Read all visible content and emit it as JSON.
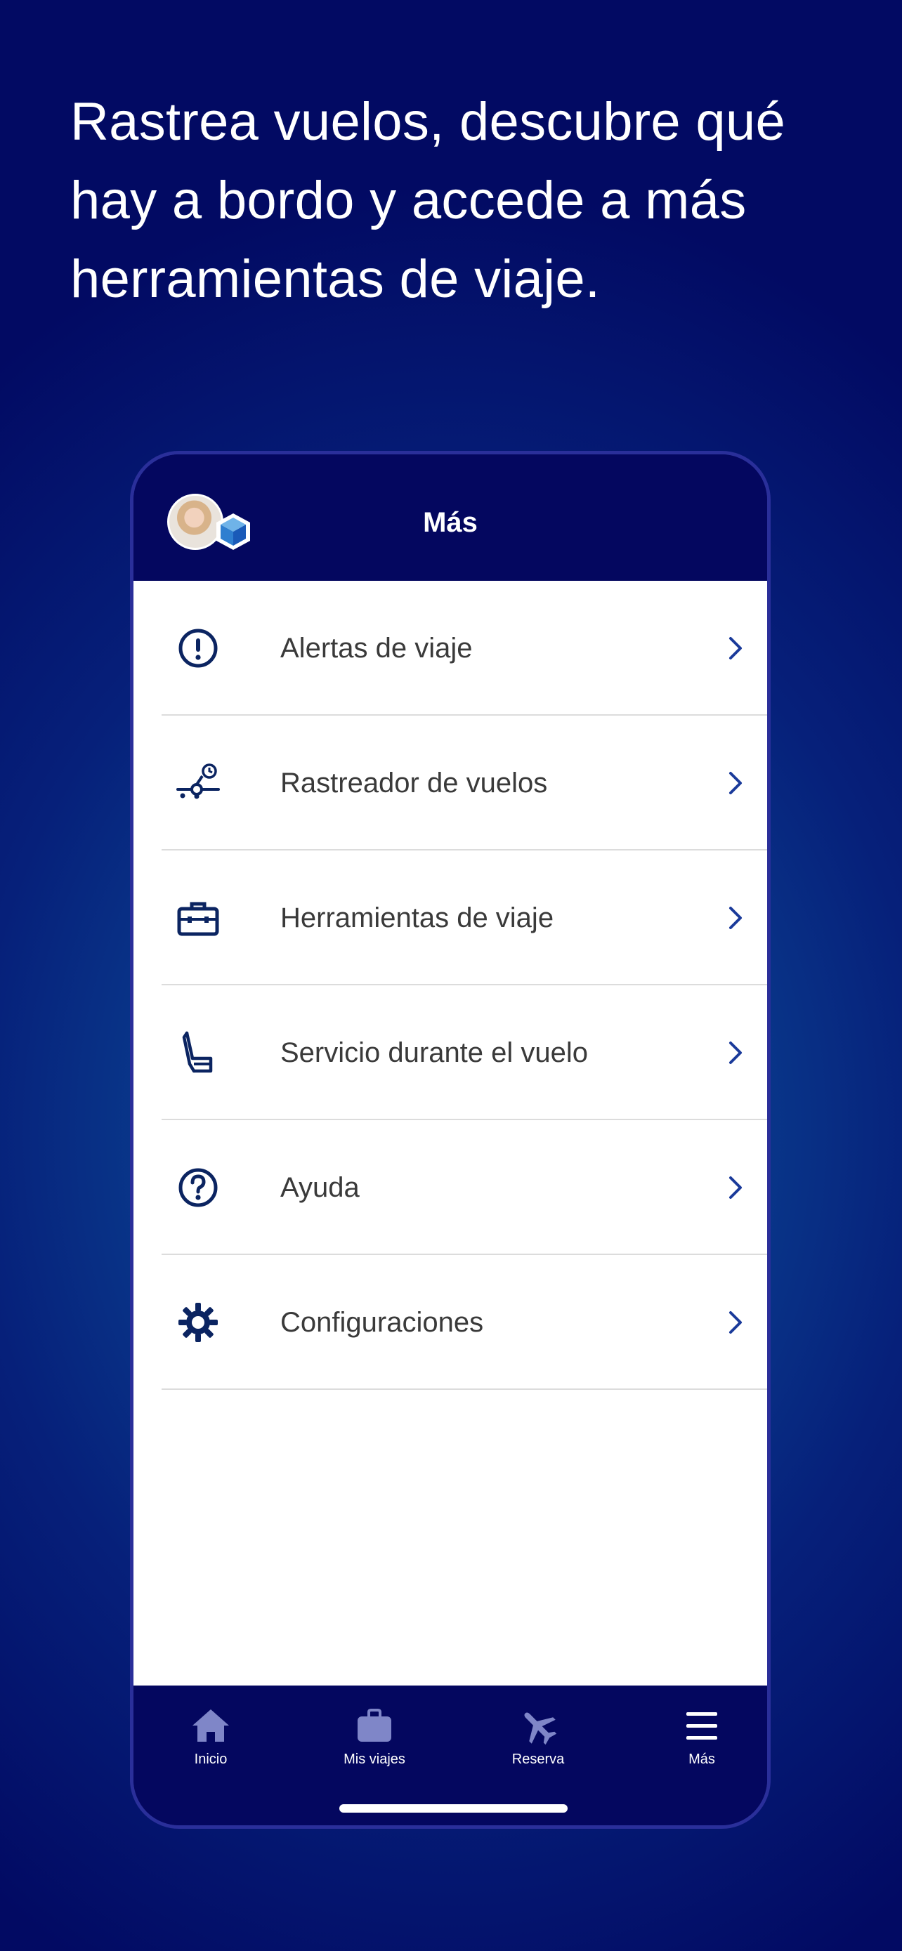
{
  "headline": "Rastrea vuelos, descubre qué hay a bordo y accede a más herramientas de viaje.",
  "screen": {
    "title": "Más",
    "avatar_icon": "profile-photo",
    "badge_icon": "membership-cube-icon"
  },
  "menu": [
    {
      "label": "Alertas de viaje",
      "icon": "alert-icon"
    },
    {
      "label": "Rastreador de vuelos",
      "icon": "flight-tracker-icon"
    },
    {
      "label": "Herramientas de viaje",
      "icon": "briefcase-icon"
    },
    {
      "label": "Servicio durante el vuelo",
      "icon": "seat-icon"
    },
    {
      "label": "Ayuda",
      "icon": "help-icon"
    },
    {
      "label": "Configuraciones",
      "icon": "gear-icon"
    }
  ],
  "tabs": [
    {
      "label": "Inicio",
      "icon": "home-icon"
    },
    {
      "label": "Mis viajes",
      "icon": "bag-icon"
    },
    {
      "label": "Reserva",
      "icon": "plane-icon"
    },
    {
      "label": "Más",
      "icon": "menu-icon"
    }
  ],
  "colors": {
    "navy": "#04075f",
    "icon_navy": "#0b2461",
    "chevron_blue": "#1a3a9a",
    "tab_icon": "#7f86c8",
    "background_glow": "#0f5aa8"
  }
}
